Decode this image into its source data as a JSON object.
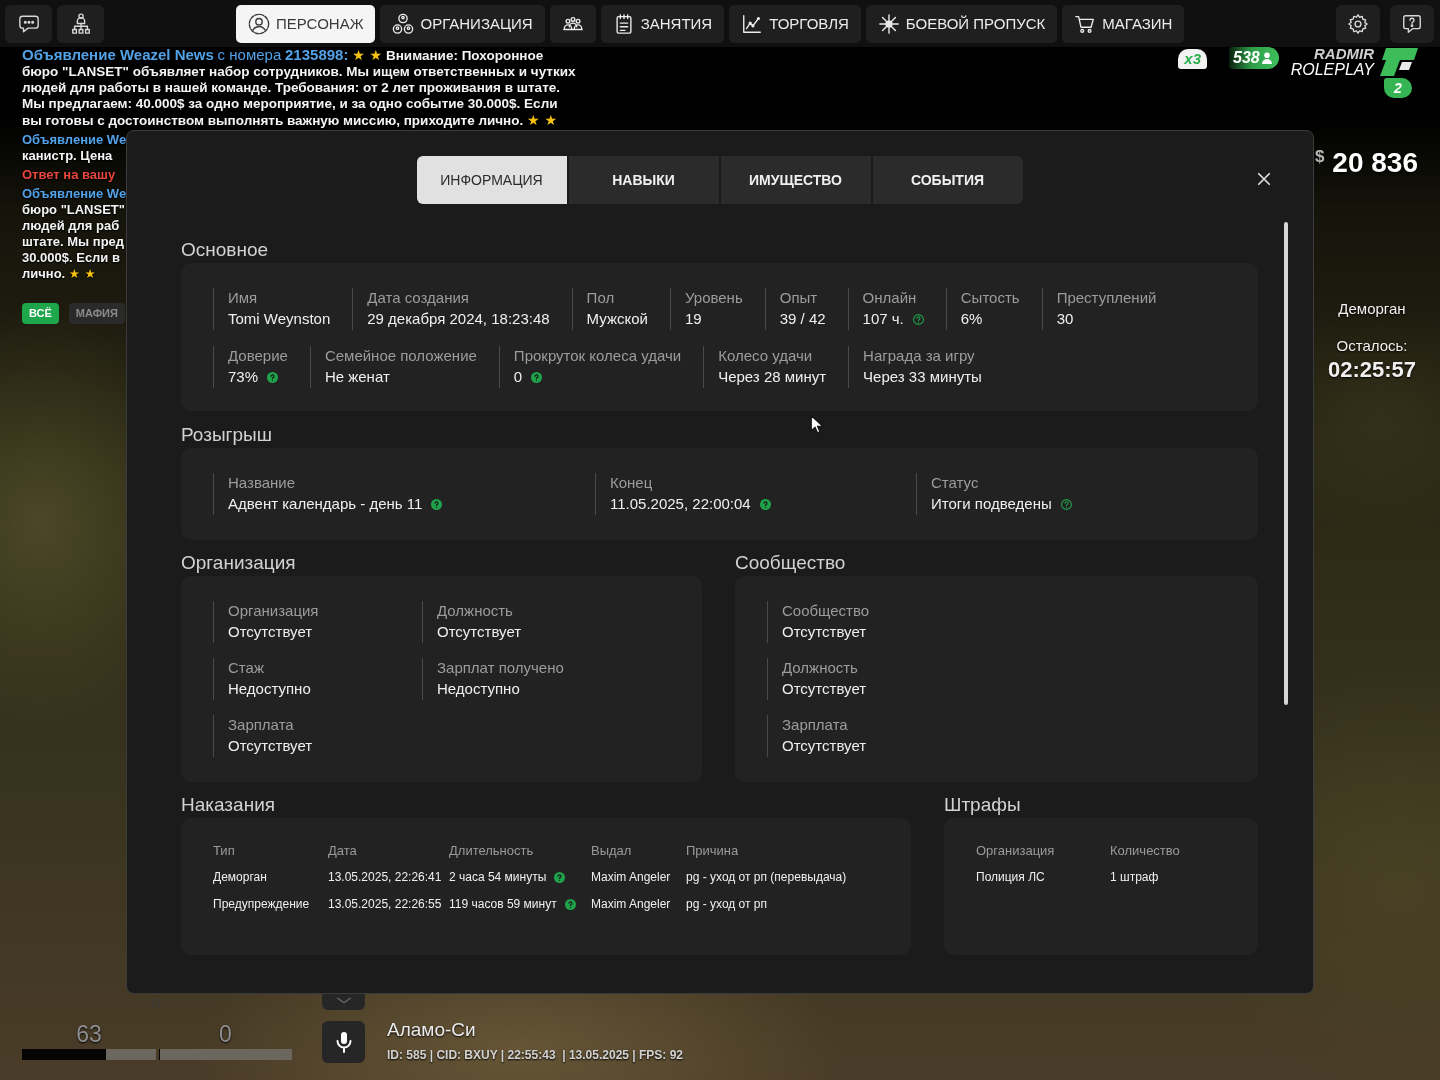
{
  "top_bar": {
    "tabs": [
      {
        "label": "ПЕРСОНАЖ",
        "selected": true
      },
      {
        "label": "ОРГАНИЗАЦИЯ",
        "selected": false
      },
      {
        "selected": false
      },
      {
        "label": "ЗАНЯТИЯ",
        "selected": false
      },
      {
        "label": "ТОРГОВЛЯ",
        "selected": false
      },
      {
        "label": "БОЕВОЙ ПРОПУСК",
        "selected": false
      },
      {
        "label": "МАГАЗИН",
        "selected": false
      }
    ]
  },
  "chat": {
    "messages": [
      {
        "parts": [
          {
            "kind": "sender",
            "text": "Объявление Weazel News"
          },
          {
            "kind": "sender_plain",
            "text": "с номера"
          },
          {
            "kind": "sender",
            "text": "2135898:"
          },
          {
            "kind": "stars",
            "text": "★ ★"
          },
          {
            "kind": "text",
            "text": "Внимание: Похоронное бюро \"LANSET\" объявляет набор сотрудников. Мы ищем ответственных и чутких людей для работы в нашей команде. Требования: от 2 лет проживания в штате. Мы предлагаем: 40.000$ за одно мероприятие, и за одно событие 30.000$. Если вы готовы с достоинством выполнять важную миссию, приходите лично."
          },
          {
            "kind": "stars",
            "text": "★ ★"
          }
        ]
      }
    ],
    "clipped_messages": [
      {
        "lines": [
          [
            {
              "kind": "sender",
              "text": "Объявление We"
            }
          ],
          [
            {
              "kind": "text",
              "text": "канистр. Цена"
            }
          ]
        ]
      },
      {
        "lines": [
          [
            {
              "kind": "reply",
              "text": "Ответ на вашу"
            }
          ]
        ]
      },
      {
        "lines": [
          [
            {
              "kind": "sender",
              "text": "Объявление We"
            }
          ],
          [
            {
              "kind": "text",
              "text": "бюро \"LANSET\""
            }
          ],
          [
            {
              "kind": "text",
              "text": "людей для раб"
            }
          ],
          [
            {
              "kind": "text",
              "text": "штате. Мы пред"
            }
          ],
          [
            {
              "kind": "text",
              "text": "30.000$. Если в"
            }
          ],
          [
            {
              "kind": "text",
              "text": "лично."
            },
            {
              "kind": "stars",
              "text": "★ ★"
            }
          ]
        ]
      }
    ],
    "filters": [
      {
        "label": "ВСЁ",
        "selected": true
      },
      {
        "label": "МАФИЯ",
        "selected": false
      }
    ]
  },
  "server_badges": {
    "multiplier": "x3",
    "online": "538",
    "logo_lines": [
      "RADMIR",
      "ROLEPLAY"
    ],
    "server": "2"
  },
  "money": {
    "currency": "$",
    "amount": "20 836"
  },
  "jail_timer": {
    "title": "Деморган",
    "label": "Осталось:",
    "time": "02:25:57"
  },
  "profile_modal": {
    "tabs": [
      {
        "label": "ИНФОРМАЦИЯ",
        "selected": true
      },
      {
        "label": "НАВЫКИ",
        "selected": false
      },
      {
        "label": "ИМУЩЕСТВО",
        "selected": false
      },
      {
        "label": "СОБЫТИЯ",
        "selected": false
      }
    ],
    "main": {
      "title": "Основное",
      "lines": [
        {
          "fields": [
            {
              "label": "Имя",
              "value": "Tomi Weynston"
            },
            {
              "label": "Дата создания",
              "value": "29 декабря 2024, 18:23:48"
            },
            {
              "label": "Пол",
              "value": "Мужской"
            },
            {
              "label": "Уровень",
              "value": "19"
            },
            {
              "label": "Опыт",
              "value": "39 / 42"
            },
            {
              "label": "Онлайн",
              "value": "107 ч.",
              "hint": {
                "kind": "outline"
              }
            },
            {
              "label": "Сытость",
              "value": "6%"
            },
            {
              "label": "Преступлений",
              "value": "30"
            }
          ]
        },
        {
          "fields": [
            {
              "label": "Доверие",
              "value": "73%",
              "hint": {
                "kind": "filled"
              }
            },
            {
              "label": "Семейное положение",
              "value": "Не женат"
            },
            {
              "label": "Прокруток колеса удачи",
              "value": "0",
              "hint": {
                "kind": "filled"
              }
            },
            {
              "label": "Колесо удачи",
              "value": "Через 28 минут"
            },
            {
              "label": "Награда за игру",
              "value": "Через 33 минуты"
            }
          ]
        }
      ]
    },
    "raffle": {
      "title": "Розыгрыш",
      "fields": [
        {
          "label": "Название",
          "value": "Адвент календарь - день 11",
          "hint": {
            "kind": "filled"
          }
        },
        {
          "label": "Конец",
          "value": "11.05.2025, 22:00:04",
          "hint": {
            "kind": "filled"
          }
        },
        {
          "label": "Статус",
          "value": "Итоги подведены",
          "hint": {
            "kind": "outline"
          }
        }
      ]
    },
    "organization": {
      "title": "Организация",
      "fields": [
        {
          "label": "Организация",
          "value": "Отсутствует"
        },
        {
          "label": "Должность",
          "value": "Отсутствует"
        },
        {
          "label": "Стаж",
          "value": "Недоступно"
        },
        {
          "label": "Зарплат получено",
          "value": "Недоступно"
        },
        {
          "label": "Зарплата",
          "value": "Отсутствует"
        }
      ]
    },
    "community": {
      "title": "Сообщество",
      "fields": [
        {
          "label": "Сообщество",
          "value": "Отсутствует"
        },
        {
          "label": "Должность",
          "value": "Отсутствует"
        },
        {
          "label": "Зарплата",
          "value": "Отсутствует"
        }
      ]
    },
    "punishments": {
      "title": "Наказания",
      "columns": [
        "Тип",
        "Дата",
        "Длительность",
        "Выдал",
        "Причина"
      ],
      "rows": [
        [
          {
            "text": "Деморган"
          },
          {
            "text": "13.05.2025, 22:26:41"
          },
          {
            "text": "2 часа 54 минуты",
            "hint": {
              "kind": "filled"
            }
          },
          {
            "text": "Maxim Angeler"
          },
          {
            "text": "pg - уход от рп (перевыдача)"
          }
        ],
        [
          {
            "text": "Предупреждение"
          },
          {
            "text": "13.05.2025, 22:26:55"
          },
          {
            "text": "119 часов 59 минут",
            "hint": {
              "kind": "filled"
            }
          },
          {
            "text": "Maxim Angeler"
          },
          {
            "text": "pg - уход от рп"
          }
        ]
      ]
    },
    "fines": {
      "title": "Штрафы",
      "columns": [
        "Организация",
        "Количество"
      ],
      "rows": [
        [
          {
            "text": "Полиция ЛС"
          },
          {
            "text": "1 штраф"
          }
        ]
      ]
    }
  },
  "status_hud": {
    "stats": [
      {
        "value": "63",
        "level": 0.63
      },
      {
        "value": "0",
        "level": 0
      }
    ]
  },
  "location": {
    "name": "Аламо-Си",
    "info": "ID: 585 | CID: BXUY | 22:55:43  | 13.05.2025 | FPS: 92"
  }
}
